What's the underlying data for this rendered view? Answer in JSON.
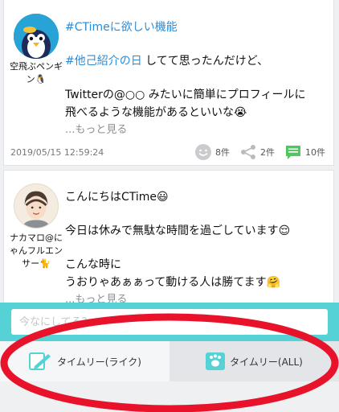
{
  "colors": {
    "accent": "#55d2d5",
    "hashtag": "#2a8cd8",
    "annotation": "#e8132a"
  },
  "posts": [
    {
      "author": "空飛ぶペンギン🐧",
      "avatar_icon": "penguin-avatar-icon",
      "lines": {
        "hashtag_line": "#CTimeに欲しい機能",
        "line2_tag": "#他己紹介の日",
        "line2_rest": " してて思ったんだけど、",
        "line3": "Twitterの@○○ みたいに簡単にプロフィールに",
        "line4": "飛べるような機能があるといいな😭",
        "more": "...もっと見る"
      },
      "timestamp": "2019/05/15 12:59:24",
      "stats": {
        "likes": "8件",
        "shares": "2件",
        "comments": "10件"
      }
    },
    {
      "author": "ナカマロ@にゃんフルエンサー🐈",
      "avatar_icon": "illustrated-man-avatar-icon",
      "lines": {
        "line1": "こんにちはCTime😃",
        "line2": "今日は休みで無駄な時間を過ごしています😌",
        "line3": "こんな時に",
        "line4": "うおりゃあぁぁって動ける人は勝てます🤗",
        "more": "...もっと見る"
      }
    }
  ],
  "composer": {
    "placeholder": "今なにしてる？"
  },
  "tabs": {
    "like": "タイムリー(ライク)",
    "all": "タイムリー(ALL)"
  }
}
